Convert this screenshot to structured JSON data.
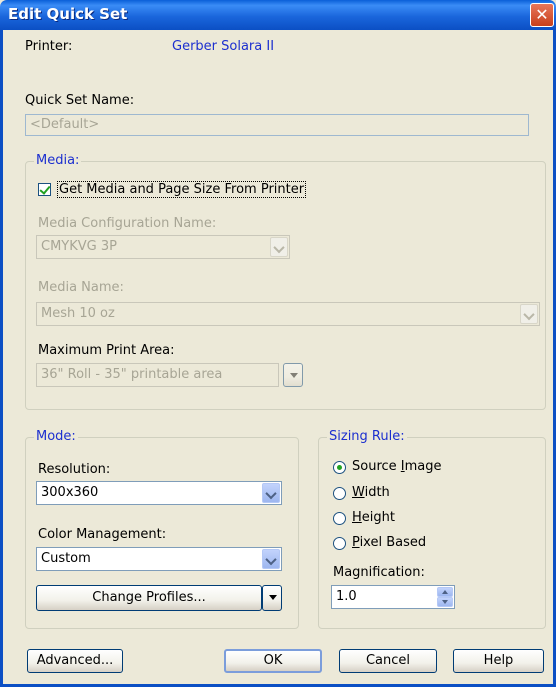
{
  "window": {
    "title": "Edit Quick Set"
  },
  "printer": {
    "label": "Printer:",
    "value": "Gerber Solara II"
  },
  "quick_set": {
    "label": "Quick Set Name:",
    "value": "<Default>"
  },
  "media": {
    "group_label": "Media:",
    "get_from_printer": {
      "label": "Get Media and Page Size From Printer",
      "checked": true
    },
    "config_name": {
      "label": "Media Configuration Name:",
      "value": "CMYKVG 3P"
    },
    "media_name": {
      "label": "Media Name:",
      "value": "Mesh 10 oz"
    },
    "max_print_area": {
      "label": "Maximum Print Area:",
      "value": "36\" Roll - 35\" printable area"
    }
  },
  "mode": {
    "group_label": "Mode:",
    "resolution": {
      "label": "Resolution:",
      "value": "300x360"
    },
    "color_management": {
      "label": "Color Management:",
      "value": "Custom"
    },
    "change_profiles_label": "Change Profiles..."
  },
  "sizing_rule": {
    "group_label": "Sizing Rule:",
    "options": [
      {
        "pre": "Source ",
        "accel": "I",
        "post": "mage",
        "checked": true
      },
      {
        "pre": "",
        "accel": "W",
        "post": "idth",
        "checked": false
      },
      {
        "pre": "",
        "accel": "H",
        "post": "eight",
        "checked": false
      },
      {
        "pre": "",
        "accel": "P",
        "post": "ixel Based",
        "checked": false
      }
    ],
    "magnification": {
      "label": "Magnification:",
      "value": "1.0"
    }
  },
  "buttons": {
    "advanced": "Advanced...",
    "ok": "OK",
    "cancel": "Cancel",
    "help": "Help"
  },
  "colors": {
    "title_bar": "#0b4fc4",
    "group_label": "#1c2fcf",
    "disabled_text": "#a7a595"
  }
}
